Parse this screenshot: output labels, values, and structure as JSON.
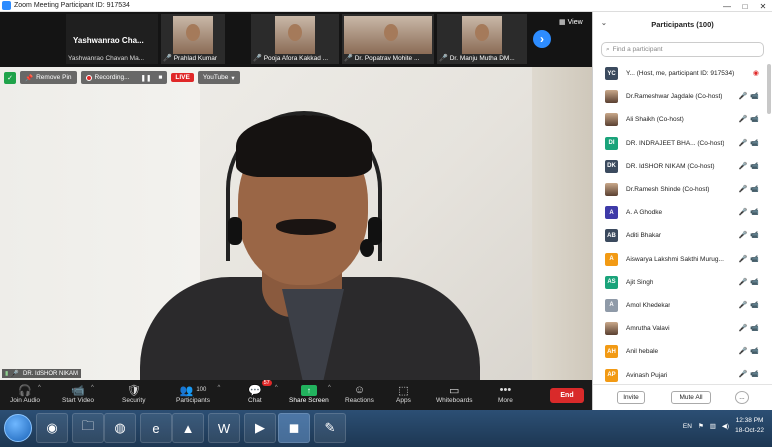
{
  "window": {
    "title": "Zoom Meeting Participant ID: 917534",
    "controls": [
      "—",
      "□",
      "✕"
    ]
  },
  "gallery": {
    "active_speaker": {
      "big_name": "Yashwanrao Cha...",
      "label": "Yashwanrao Chavan Ma..."
    },
    "tiles": [
      {
        "name": "Prahlad Kumar"
      },
      {
        "name": "Pooja Afora Kakkad ..."
      },
      {
        "name": "Dr. Popatrav Mohite ..."
      },
      {
        "name": "Dr. Manju Mutha DM..."
      }
    ],
    "view_label": "View"
  },
  "video_toolbar": {
    "remove_pin": "Remove Pin",
    "recording": "Recording...",
    "pause": "❚❚",
    "stop": "■",
    "live": "LIVE",
    "youtube": "YouTube"
  },
  "speaker_tag": "DR. IdSHOR NIKAM",
  "controls": {
    "join_audio": "Join Audio",
    "start_video": "Start Video",
    "security": "Security",
    "participants": "Participants",
    "participants_count": "100",
    "chat": "Chat",
    "chat_badge": "57",
    "share_screen": "Share Screen",
    "reactions": "Reactions",
    "apps": "Apps",
    "whiteboards": "Whiteboards",
    "more": "More",
    "end": "End"
  },
  "panel": {
    "title": "Participants (100)",
    "search_placeholder": "Find a participant",
    "participants": [
      {
        "initials": "YC",
        "color": "#3b4a5e",
        "name": "Y... (Host, me, participant ID: 917534)"
      },
      {
        "initials": "",
        "color": "",
        "name": "Dr.Rameshwar Jagdale (Co-host)"
      },
      {
        "initials": "",
        "color": "",
        "name": "Ali Shaikh (Co-host)"
      },
      {
        "initials": "DI",
        "color": "#1aa37a",
        "name": "DR. INDRAJEET BHA...  (Co-host)"
      },
      {
        "initials": "DK",
        "color": "#3b4a5e",
        "name": "DR. IdSHOR NIKAM (Co-host)"
      },
      {
        "initials": "",
        "color": "",
        "name": "Dr.Ramesh Shinde (Co-host)"
      },
      {
        "initials": "A",
        "color": "#3e3aa8",
        "name": "A. A Ghodke"
      },
      {
        "initials": "AB",
        "color": "#3b4a5e",
        "name": "Aditi Bhakar"
      },
      {
        "initials": "A",
        "color": "#f29a14",
        "name": "Aiswarya Lakshmi Sakthi Murug..."
      },
      {
        "initials": "AS",
        "color": "#1aa37a",
        "name": "Ajit Singh"
      },
      {
        "initials": "A",
        "color": "#8f9aa8",
        "name": "Amol Khedekar"
      },
      {
        "initials": "",
        "color": "",
        "name": "Amrutha Valavi"
      },
      {
        "initials": "AH",
        "color": "#f29a14",
        "name": "Anil hebale"
      },
      {
        "initials": "AP",
        "color": "#f29a14",
        "name": "Avinash Pujari"
      }
    ],
    "invite": "Invite",
    "mute_all": "Mute All",
    "more": "..."
  },
  "taskbar": {
    "lang": "EN",
    "time": "12:38 PM",
    "date": "18-Oct-22"
  }
}
